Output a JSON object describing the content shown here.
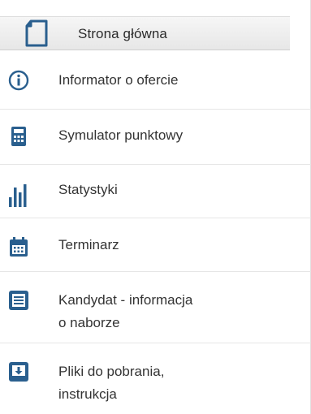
{
  "colors": {
    "icon": "#2a5f8e",
    "text": "#333333",
    "header_bg": "#ececec",
    "divider": "#e6e6e6"
  },
  "header": {
    "label": "Strona główna",
    "icon": "document-icon"
  },
  "items": [
    {
      "icon": "info-icon",
      "lines": [
        "Informator o ofercie"
      ]
    },
    {
      "icon": "calculator-icon",
      "lines": [
        "Symulator punktowy"
      ]
    },
    {
      "icon": "bar-chart-icon",
      "lines": [
        "Statystyki"
      ]
    },
    {
      "icon": "calendar-icon",
      "lines": [
        "Terminarz"
      ]
    },
    {
      "icon": "document-list-icon",
      "lines": [
        "Kandydat - informacja",
        "o naborze"
      ]
    },
    {
      "icon": "download-tray-icon",
      "lines": [
        "Pliki do pobrania,",
        "instrukcja"
      ]
    }
  ]
}
